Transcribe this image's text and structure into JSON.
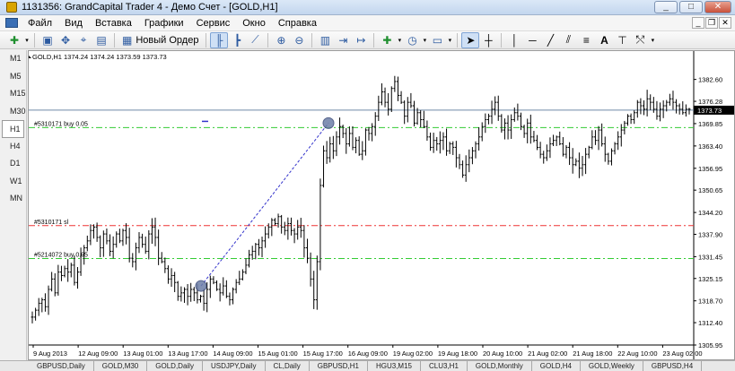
{
  "window": {
    "title": "1131356: GrandCapital Trader 4 - Демо Счет - [GOLD,H1]"
  },
  "menu": [
    "Файл",
    "Вид",
    "Вставка",
    "Графики",
    "Сервис",
    "Окно",
    "Справка"
  ],
  "toolbar": {
    "new_order_label": "Новый Ордер"
  },
  "periods": [
    "M1",
    "M5",
    "M15",
    "M30",
    "H1",
    "H4",
    "D1",
    "W1",
    "MN"
  ],
  "active_period": "H1",
  "chart": {
    "info": "GOLD,H1  1374.24 1374.24 1373.59 1373.73",
    "current_price": "1373.73",
    "order_labels": {
      "buy1": "#5310171 buy 0.05",
      "sl1": "#5310171 sl",
      "buy2": "#5214072 buy 0.05"
    },
    "colors": {
      "bars": "#000000",
      "buy_line": "#33cc33",
      "sl_line": "#ee3333",
      "current_line": "#6f8aa6",
      "trade_arrow": "#3333cc"
    }
  },
  "chart_data": {
    "type": "ohlc",
    "symbol": "GOLD",
    "timeframe": "H1",
    "ylim": [
      1305.95,
      1385.61
    ],
    "y_ticks": [
      "1382.60",
      "1376.28",
      "1369.85",
      "1363.40",
      "1356.95",
      "1350.65",
      "1344.20",
      "1337.90",
      "1331.45",
      "1325.15",
      "1318.70",
      "1312.40",
      "1305.95"
    ],
    "x_ticks": [
      "9 Aug 2013",
      "12 Aug 09:00",
      "13 Aug 01:00",
      "13 Aug 17:00",
      "14 Aug 09:00",
      "15 Aug 01:00",
      "15 Aug 17:00",
      "16 Aug 09:00",
      "19 Aug 02:00",
      "19 Aug 18:00",
      "20 Aug 10:00",
      "21 Aug 02:00",
      "21 Aug 18:00",
      "22 Aug 10:00",
      "23 Aug 02:00"
    ],
    "horizontal_lines": [
      {
        "name": "#5310171 buy 0.05",
        "price": 1368.7,
        "style": "dash-dot",
        "color": "green"
      },
      {
        "name": "#5310171 sl",
        "price": 1340.4,
        "style": "dash-dot",
        "color": "red"
      },
      {
        "name": "#5214072 buy 0.05",
        "price": 1330.9,
        "style": "dash-dot",
        "color": "green"
      },
      {
        "name": "current",
        "price": 1373.73,
        "style": "solid",
        "color": "steelblue"
      }
    ],
    "trade_segment": {
      "from_price": 1323.0,
      "to_price": 1370.0
    },
    "closes": [
      1314,
      1316,
      1318,
      1319,
      1317,
      1322,
      1325,
      1321,
      1327,
      1326,
      1328,
      1327,
      1329,
      1324,
      1327,
      1332,
      1334,
      1336,
      1339,
      1340,
      1337,
      1334,
      1338,
      1336,
      1333,
      1335,
      1338,
      1336,
      1339,
      1337,
      1331,
      1330,
      1334,
      1337,
      1335,
      1333,
      1338,
      1340,
      1337,
      1331,
      1330,
      1328,
      1325,
      1326,
      1324,
      1320,
      1321,
      1322,
      1320,
      1322,
      1321,
      1319,
      1320,
      1318,
      1322,
      1325,
      1324,
      1322,
      1321,
      1323,
      1320,
      1319,
      1322,
      1324,
      1325,
      1327,
      1329,
      1332,
      1333,
      1335,
      1334,
      1336,
      1338,
      1340,
      1342,
      1341,
      1343,
      1340,
      1339,
      1341,
      1339,
      1338,
      1340,
      1339,
      1334,
      1331,
      1325,
      1319,
      1330,
      1352,
      1362,
      1360,
      1364,
      1362,
      1366,
      1369,
      1367,
      1364,
      1367,
      1363,
      1365,
      1361,
      1362,
      1368,
      1367,
      1369,
      1372,
      1376,
      1379,
      1376,
      1374,
      1380,
      1382,
      1378,
      1376,
      1372,
      1376,
      1375,
      1370,
      1373,
      1371,
      1369,
      1366,
      1363,
      1365,
      1364,
      1365,
      1366,
      1362,
      1364,
      1363,
      1360,
      1358,
      1355,
      1358,
      1360,
      1362,
      1364,
      1366,
      1369,
      1371,
      1372,
      1374,
      1376,
      1372,
      1368,
      1370,
      1368,
      1371,
      1373,
      1372,
      1369,
      1367,
      1370,
      1366,
      1365,
      1363,
      1361,
      1360,
      1362,
      1364,
      1365,
      1366,
      1364,
      1361,
      1363,
      1360,
      1358,
      1359,
      1357,
      1358,
      1361,
      1363,
      1366,
      1365,
      1368,
      1364,
      1361,
      1359,
      1362,
      1364,
      1366,
      1368,
      1370,
      1372,
      1371,
      1373,
      1376,
      1375,
      1374,
      1377,
      1376,
      1374,
      1372,
      1374,
      1375,
      1376,
      1377,
      1376,
      1375,
      1374,
      1373,
      1374,
      1374
    ]
  },
  "symbol_tabs": [
    "GBPUSD,Daily",
    "GOLD,M30",
    "GOLD,Daily",
    "USDJPY,Daily",
    "CL,Daily",
    "GBPUSD,H1",
    "HGU3,M15",
    "CLU3,H1",
    "GOLD,Monthly",
    "GOLD,H4",
    "GOLD,Weekly",
    "GBPUSD,H4"
  ],
  "active_tab": "GOLD,H1"
}
